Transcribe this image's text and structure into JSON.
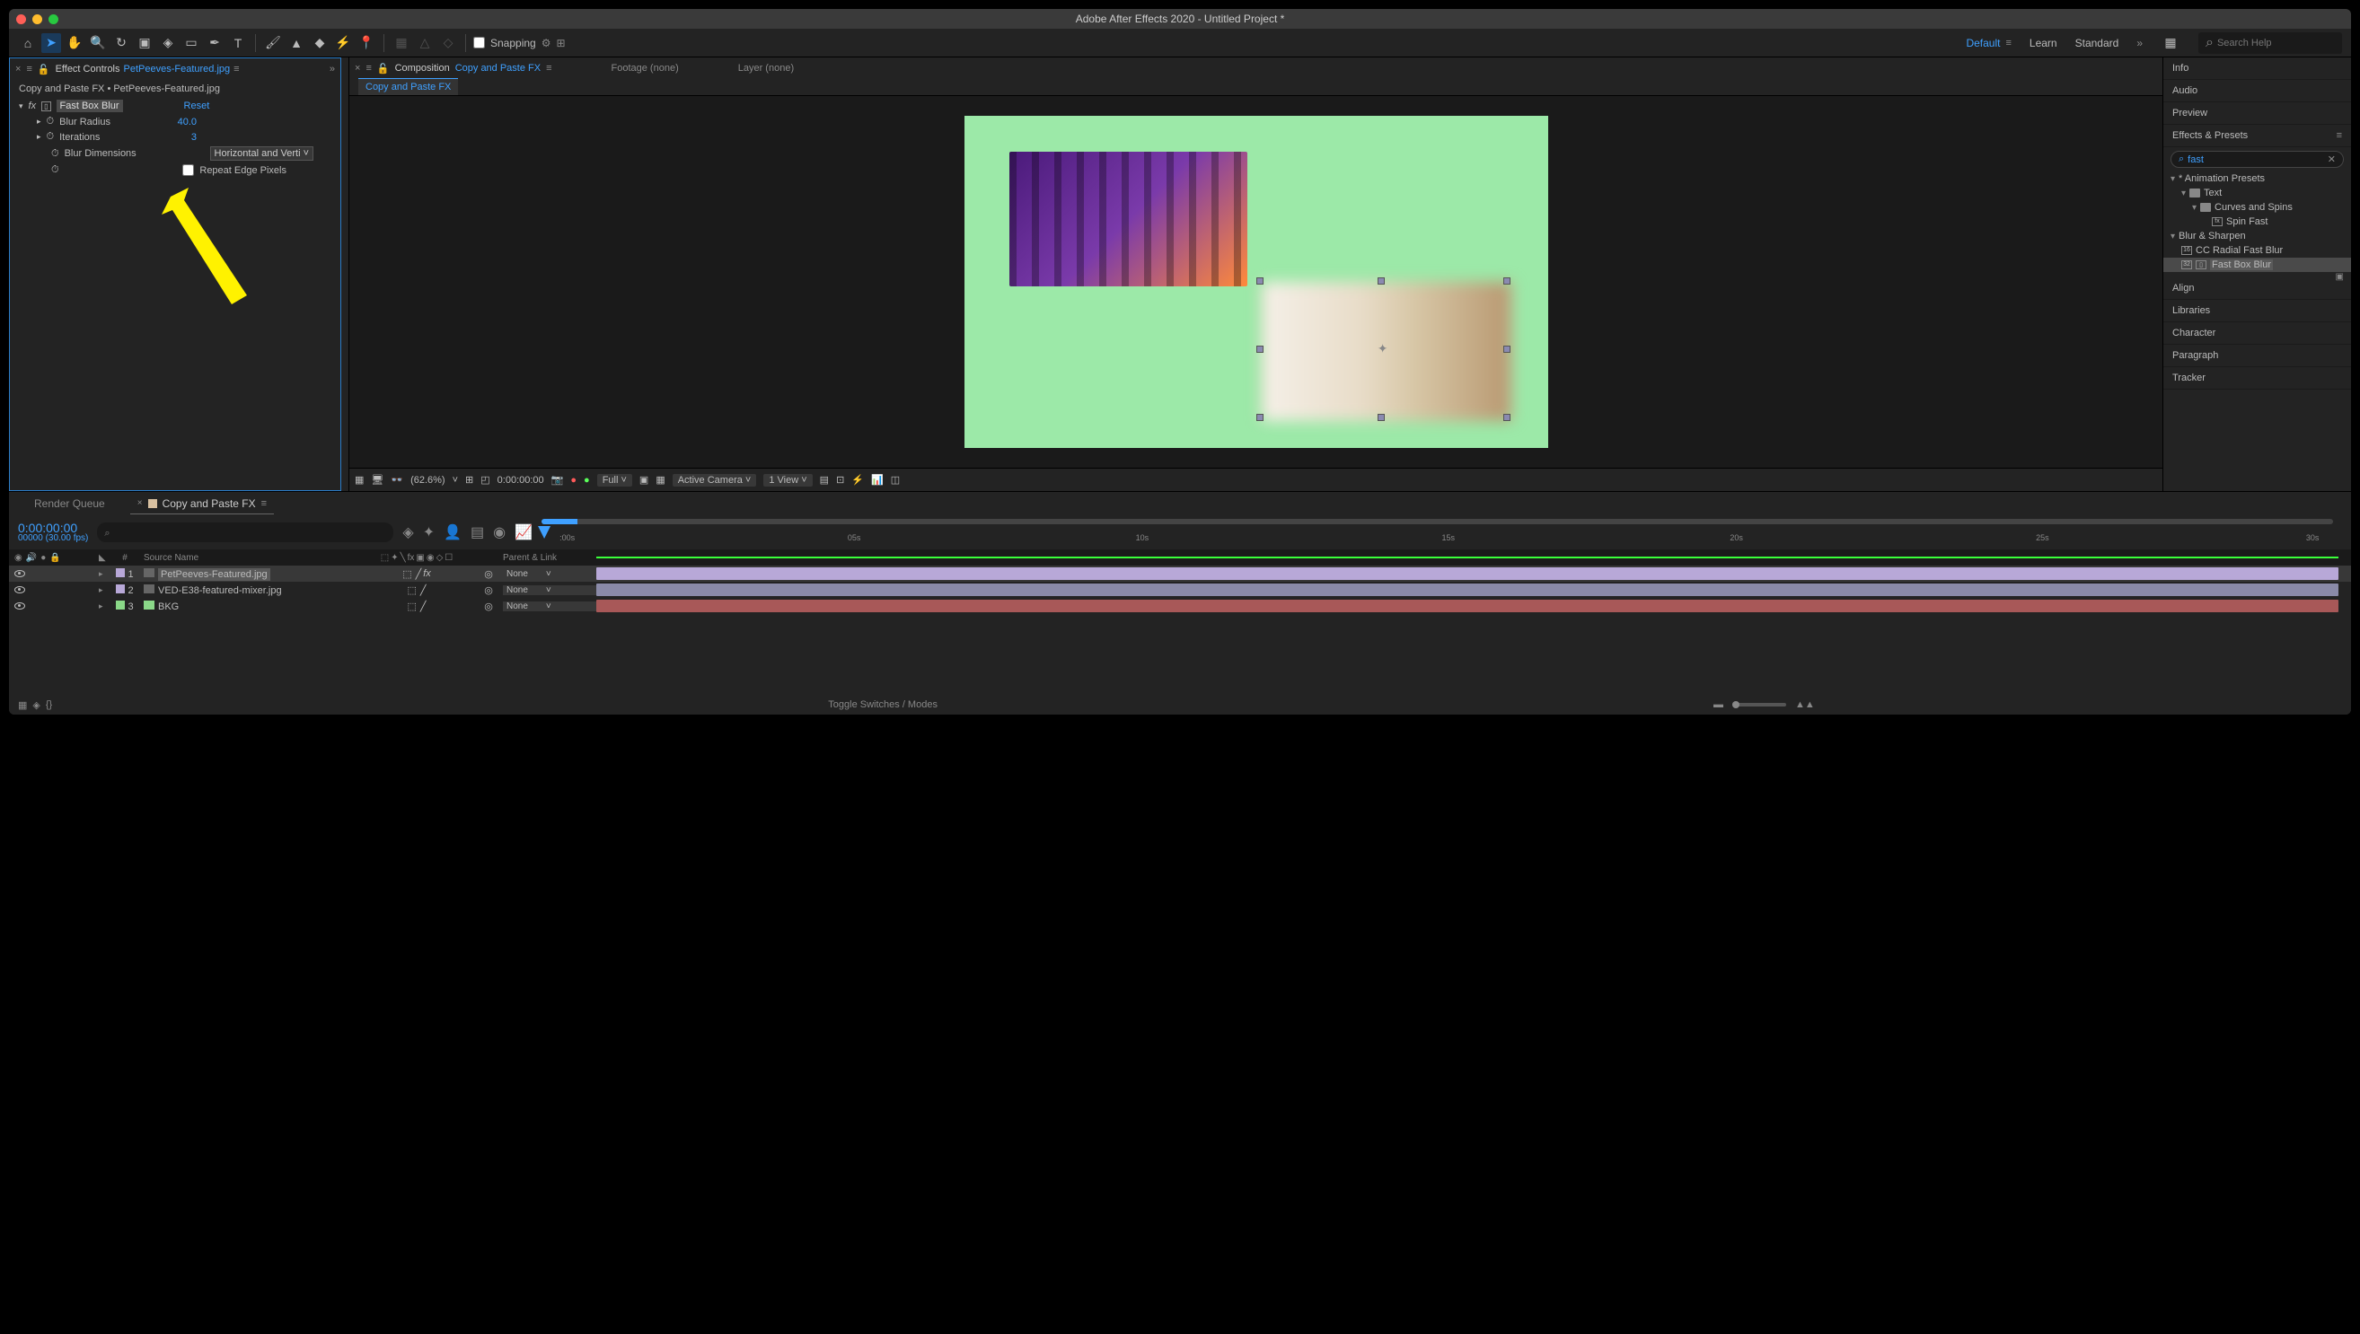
{
  "title": "Adobe After Effects 2020 - Untitled Project *",
  "toolbar": {
    "snapping_label": "Snapping"
  },
  "workspaces": {
    "default": "Default",
    "learn": "Learn",
    "standard": "Standard"
  },
  "search_help_placeholder": "Search Help",
  "effect_controls": {
    "panel_label": "Effect Controls",
    "file_name": "PetPeeves-Featured.jpg",
    "path": "Copy and Paste FX • PetPeeves-Featured.jpg",
    "effect_name": "Fast Box Blur",
    "reset_label": "Reset",
    "blur_radius_label": "Blur Radius",
    "blur_radius_value": "40.0",
    "iterations_label": "Iterations",
    "iterations_value": "3",
    "blur_dimensions_label": "Blur Dimensions",
    "blur_dimensions_value": "Horizontal and Verti",
    "repeat_edge_label": "Repeat Edge Pixels"
  },
  "composition": {
    "panel_label": "Composition",
    "name": "Copy and Paste FX",
    "footage_label": "Footage (none)",
    "layer_label": "Layer (none)",
    "subtab": "Copy and Paste FX"
  },
  "viewer_controls": {
    "zoom": "(62.6%)",
    "timecode": "0:00:00:00",
    "resolution": "Full",
    "camera": "Active Camera",
    "view_count": "1 View"
  },
  "right_panel": {
    "info": "Info",
    "audio": "Audio",
    "preview": "Preview",
    "effects_presets": "Effects & Presets",
    "search_value": "fast",
    "animation_presets": "* Animation Presets",
    "text_folder": "Text",
    "curves_spins": "Curves and Spins",
    "spin_fast": "Spin Fast",
    "blur_sharpen": "Blur & Sharpen",
    "cc_radial": "CC Radial Fast Blur",
    "fast_box_blur": "Fast Box Blur",
    "align": "Align",
    "libraries": "Libraries",
    "character": "Character",
    "paragraph": "Paragraph",
    "tracker": "Tracker"
  },
  "timeline": {
    "render_queue": "Render Queue",
    "comp_name": "Copy and Paste FX",
    "current_time": "0:00:00:00",
    "fps": "00000 (30.00 fps)",
    "col_num": "#",
    "col_source": "Source Name",
    "col_parent": "Parent & Link",
    "ruler_marks": [
      ":00s",
      "05s",
      "10s",
      "15s",
      "20s",
      "25s",
      "30s"
    ],
    "layers": [
      {
        "num": "1",
        "name": "PetPeeves-Featured.jpg",
        "color": "#b8a8d8",
        "parent": "None",
        "bar_color": "#b8a8d8"
      },
      {
        "num": "2",
        "name": "VED-E38-featured-mixer.jpg",
        "color": "#b8a8d8",
        "parent": "None",
        "bar_color": "#8a8aa8"
      },
      {
        "num": "3",
        "name": "BKG",
        "color": "#8ad888",
        "parent": "None",
        "bar_color": "#a85858"
      }
    ],
    "toggle_modes": "Toggle Switches / Modes"
  }
}
